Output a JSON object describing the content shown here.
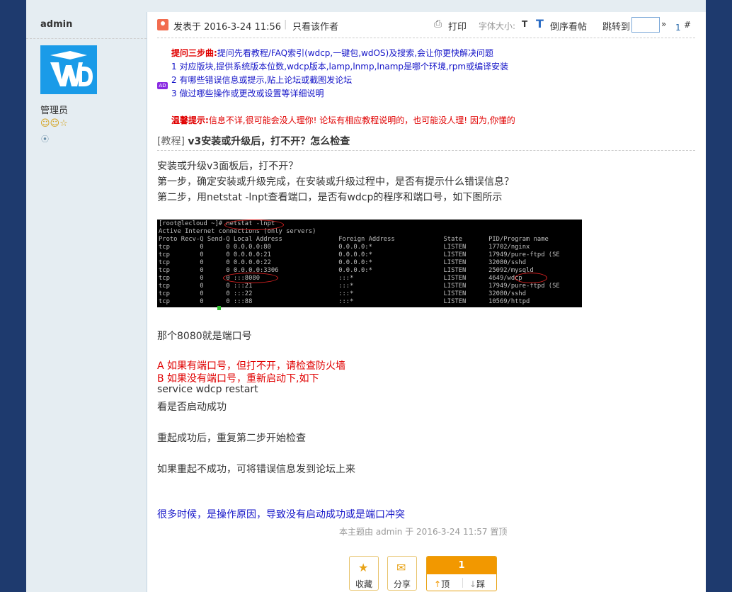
{
  "author": {
    "name": "admin",
    "role": "管理员",
    "stars": "☺☺☆",
    "online_icon": "⦿"
  },
  "post_header": {
    "posted": "发表于 2016-3-24 11:56",
    "separator": "|",
    "only_author": "只看该作者",
    "print_icon": "⎙",
    "print": "打印",
    "font_size": "字体大小:",
    "font_small": "T",
    "reverse_icon": "T",
    "reverse": "倒序看帖",
    "jump_to": "跳转到",
    "jump_arrow": "»",
    "floor_number": "1",
    "floor_hash": "#"
  },
  "notice": {
    "ad": "AD",
    "title": "提问三步曲:",
    "title_text": "提问先看教程/FAQ索引(wdcp,一键包,wdOS)及搜索,会让你更快解决问题",
    "line1": "1 对应版块,提供系统版本位数,wdcp版本,lamp,lnmp,lnamp是哪个环境,rpm或编译安装",
    "line2": "2 有哪些错误信息或提示,贴上论坛或截图发论坛",
    "line3": "3 做过哪些操作或更改或设置等详细说明",
    "warm_title": "温馨提示:",
    "warm_text": "信息不详,很可能会没人理你! 论坛有相应教程说明的，也可能没人理! 因为,你懂的"
  },
  "thread": {
    "type": "[教程]",
    "subject": "v3安装或升级后，打不开？怎么检查"
  },
  "content": {
    "p1": "安装或升级v3面板后，打不开？",
    "p2": "第一步，确定安装或升级完成，在安装或升级过程中，是否有提示什么错误信息？",
    "p3": "第二步，用netstat -lnpt查看端口，是否有wdcp的程序和端口号，如下图所示",
    "p4": "那个8080就是端口号",
    "p5": "A 如果有端口号，但打不开，请检查防火墙",
    "p6": "B  如果没有端口号，重新启动下,如下",
    "p7": "service wdcp restart",
    "p8": "看是否启动成功",
    "p9": "重起成功后，重复第二步开始检查",
    "p10": "如果重起不成功，可将错误信息发到论坛上来",
    "p11": "很多时候，是操作原因，导致没有启动成功或是端口冲突"
  },
  "terminal": {
    "lines": [
      "[root@lecloud ~]# netstat -lnpt",
      "Active Internet connections (only servers)",
      "Proto Recv-Q Send-Q Local Address               Foreign Address             State       PID/Program name",
      "tcp        0      0 0.0.0.0:80                  0.0.0.0:*                   LISTEN      17702/nginx",
      "tcp        0      0 0.0.0.0:21                  0.0.0.0:*                   LISTEN      17949/pure-ftpd (SE",
      "tcp        0      0 0.0.0.0:22                  0.0.0.0:*                   LISTEN      32080/sshd",
      "tcp        0      0 0.0.0.0:3306                0.0.0.0:*                   LISTEN      25092/mysqld",
      "tcp        0      0 :::8080                     :::*                        LISTEN      4649/wdcp",
      "tcp        0      0 :::21                       :::*                        LISTEN      17949/pure-ftpd (SE",
      "tcp        0      0 :::22                       :::*                        LISTEN      32080/sshd",
      "tcp        0      0 :::88                       :::*                        LISTEN      10569/httpd"
    ]
  },
  "edit_note": "本主题由 admin 于 2016-3-24 11:57 置顶",
  "actions": {
    "fav_icon": "★",
    "favorite": "收藏",
    "share_icon": "✉",
    "share": "分享",
    "vote_count": "1",
    "up_arrow": "↑",
    "up": "顶",
    "down_arrow": "↓",
    "down": "踩"
  },
  "colors": {
    "background": "#1e3a6e",
    "sidebar": "#e5edf2",
    "accent_orange": "#f29800",
    "link_blue": "#1515c8",
    "alert_red": "#e00000"
  }
}
